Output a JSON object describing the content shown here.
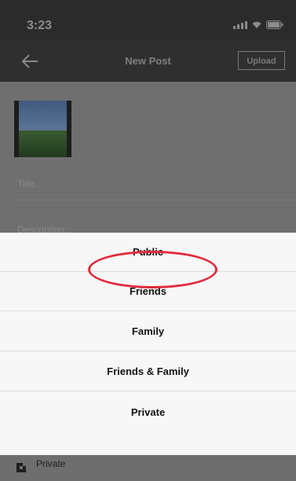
{
  "status_bar": {
    "time": "3:23"
  },
  "nav": {
    "title": "New Post",
    "upload_label": "Upload"
  },
  "form": {
    "title_placeholder": "Title...",
    "description_placeholder": "Description..."
  },
  "privacy_sheet": {
    "options": [
      {
        "label": "Public",
        "selected": true
      },
      {
        "label": "Friends",
        "selected": false
      },
      {
        "label": "Family",
        "selected": false
      },
      {
        "label": "Friends & Family",
        "selected": false
      },
      {
        "label": "Private",
        "selected": false
      }
    ],
    "highlight_color": "#e12b3c"
  },
  "bottom": {
    "privacy_label": "Private"
  }
}
